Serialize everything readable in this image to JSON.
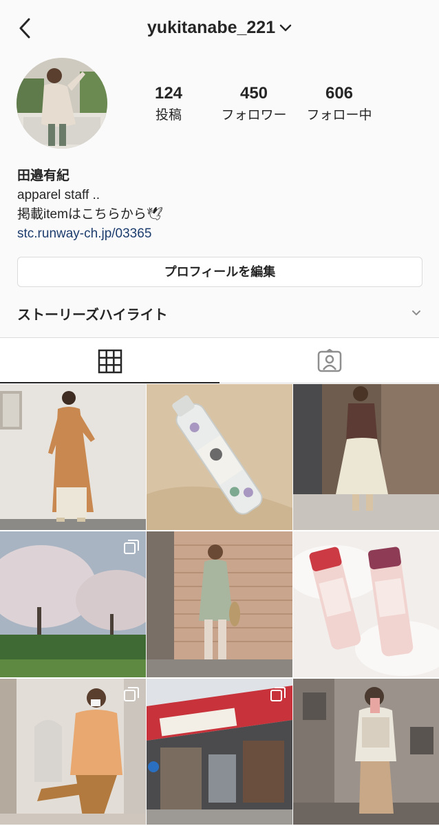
{
  "header": {
    "username": "yukitanabe_221"
  },
  "profile": {
    "stats": [
      {
        "value": "124",
        "label": "投稿"
      },
      {
        "value": "450",
        "label": "フォロワー"
      },
      {
        "value": "606",
        "label": "フォロー中"
      }
    ],
    "name": "田邉有紀",
    "bio_line1": "apparel staff ..",
    "bio_line2": "掲載itemはこちらから🕊",
    "link": "stc.runway-ch.jp/03365",
    "edit_button": "プロフィールを編集",
    "highlights_label": "ストーリーズハイライト"
  },
  "tabs": [
    {
      "icon": "grid-icon",
      "active": true
    },
    {
      "icon": "tagged-person-icon",
      "active": false
    }
  ],
  "grid": {
    "posts": [
      {
        "subject": "floral dress outfit",
        "multi": false
      },
      {
        "subject": "bath salts bottle",
        "multi": false
      },
      {
        "subject": "brown blazer and white skirt",
        "multi": false
      },
      {
        "subject": "cherry blossom trees",
        "multi": true
      },
      {
        "subject": "mint green outfit",
        "multi": false
      },
      {
        "subject": "pink cosmetic bottles",
        "multi": false
      },
      {
        "subject": "cardigan outfit on chair",
        "multi": true
      },
      {
        "subject": "shopping street arcade",
        "multi": true
      },
      {
        "subject": "mirror selfie in elevator",
        "multi": false
      }
    ]
  }
}
